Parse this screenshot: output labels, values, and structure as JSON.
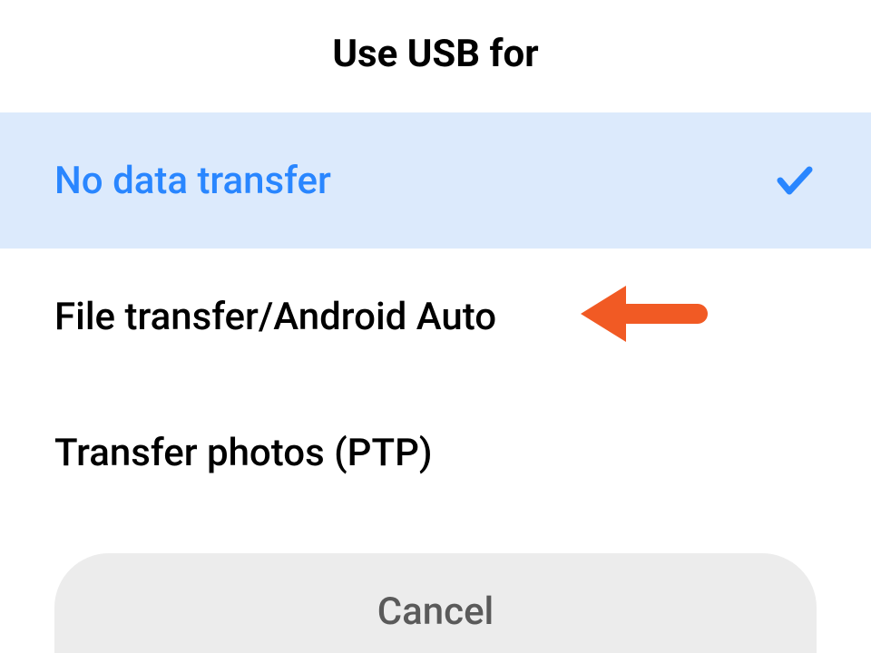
{
  "title": "Use USB for",
  "options": [
    {
      "label": "No data transfer",
      "selected": true
    },
    {
      "label": "File transfer/Android Auto",
      "selected": false
    },
    {
      "label": "Transfer photos (PTP)",
      "selected": false
    }
  ],
  "cancel_label": "Cancel",
  "colors": {
    "accent": "#2986ff",
    "selected_bg": "#dceafc",
    "arrow": "#f15a24"
  }
}
